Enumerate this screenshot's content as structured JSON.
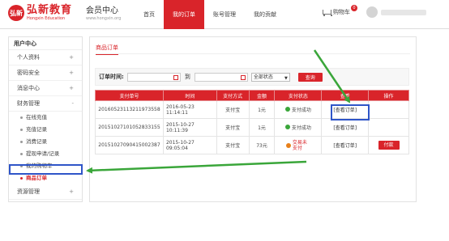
{
  "header": {
    "logo_mark": "弘新",
    "logo_title": "弘新教育",
    "logo_sub": "Hongxin Education",
    "brand_title": "会员中心",
    "brand_url": "www.hongxin.org",
    "nav": [
      "首页",
      "我的订单",
      "账号管理",
      "我的贡献"
    ],
    "active_nav": 1,
    "cart_label": "购物车",
    "cart_count": "0"
  },
  "sidebar": {
    "title": "用户中心",
    "groups": [
      {
        "label": "个人资料",
        "toggle": "+"
      },
      {
        "label": "密码安全",
        "toggle": "+"
      },
      {
        "label": "消息中心",
        "toggle": "+"
      },
      {
        "label": "财务管理",
        "toggle": "-"
      }
    ],
    "sub_items": [
      "在线充值",
      "充值记录",
      "消费记录",
      "提现申请/记录",
      "我的购物车",
      "商品订单"
    ],
    "current_sub": 5,
    "last_group": {
      "label": "资源管理",
      "toggle": "+"
    }
  },
  "main": {
    "tab": "商品订单",
    "filter": {
      "label": "订单时间:",
      "to_label": "到",
      "status_value": "全部状态",
      "query_button": "查询"
    },
    "columns": [
      "支付单号",
      "时间",
      "支付方式",
      "金额",
      "支付状态",
      "查看",
      "操作"
    ],
    "rows": [
      {
        "id": "20160523113211973558",
        "date": "2016-05-23",
        "time": "11:14:11",
        "method": "支付宝",
        "amount": "1元",
        "status": "支付成功",
        "status_type": "ok",
        "view": "[查看订单]",
        "action": ""
      },
      {
        "id": "20151027101052833155",
        "date": "2015-10-27",
        "time": "10:11:39",
        "method": "支付宝",
        "amount": "1元",
        "status": "支付成功",
        "status_type": "ok",
        "view": "[查看订单]",
        "action": ""
      },
      {
        "id": "20151027090415002387",
        "date": "2015-10-27",
        "time": "09:05:04",
        "method": "支付宝",
        "amount": "73元",
        "status": "交易未支付",
        "status_type": "fail",
        "view": "[查看订单]",
        "action": "付款"
      }
    ]
  },
  "colors": {
    "brand_red": "#d9242a",
    "highlight_blue": "#2f55c8",
    "arrow_green": "#3aa63a"
  }
}
